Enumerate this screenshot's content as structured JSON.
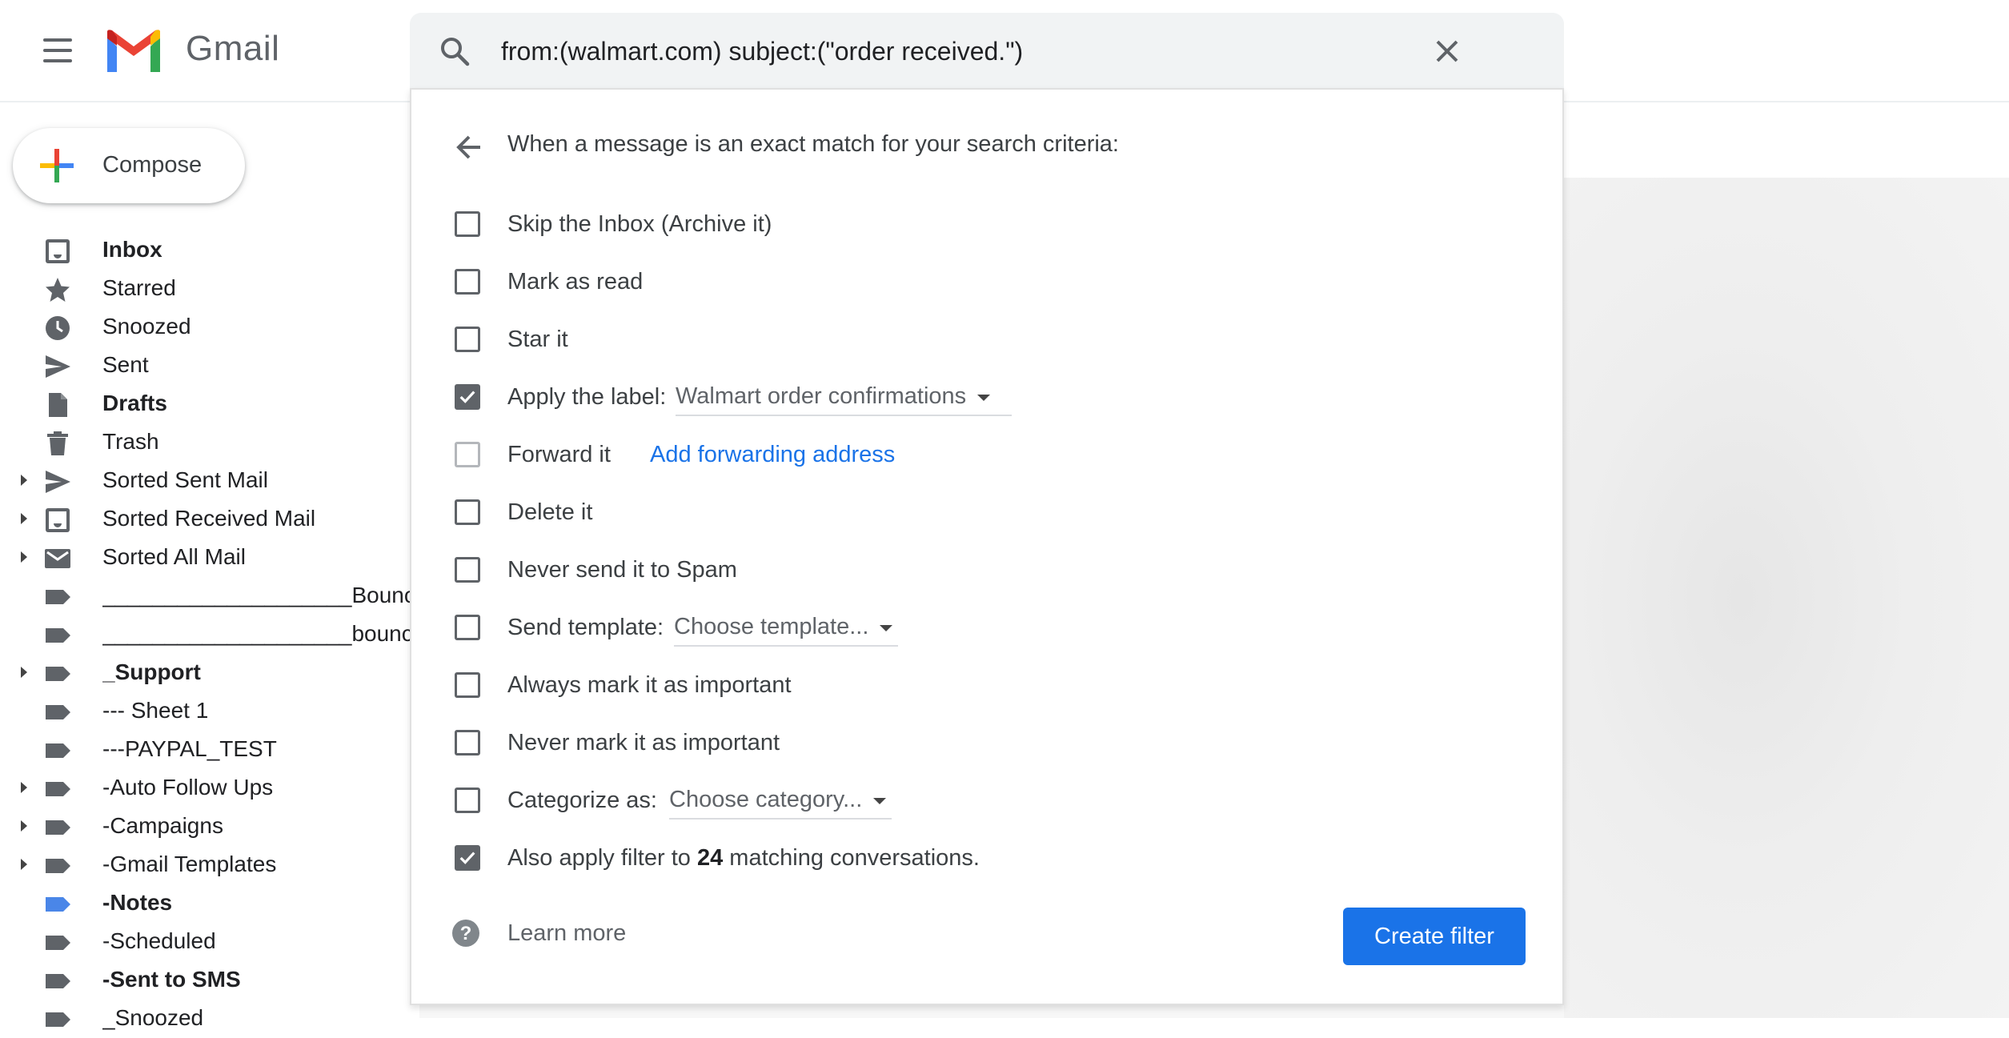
{
  "app": {
    "name": "Gmail"
  },
  "search": {
    "query": "from:(walmart.com) subject:(\"order received.\")"
  },
  "compose": {
    "label": "Compose"
  },
  "sidebar": {
    "items": [
      {
        "label": "Inbox",
        "icon": "inbox-icon",
        "bold": true,
        "expandable": false
      },
      {
        "label": "Starred",
        "icon": "star-icon",
        "bold": false,
        "expandable": false
      },
      {
        "label": "Snoozed",
        "icon": "clock-icon",
        "bold": false,
        "expandable": false
      },
      {
        "label": "Sent",
        "icon": "send-icon",
        "bold": false,
        "expandable": false
      },
      {
        "label": "Drafts",
        "icon": "draft-icon",
        "bold": true,
        "expandable": false
      },
      {
        "label": "Trash",
        "icon": "trash-icon",
        "bold": false,
        "expandable": false
      },
      {
        "label": "Sorted Sent Mail",
        "icon": "send-icon",
        "bold": false,
        "expandable": true
      },
      {
        "label": "Sorted Received Mail",
        "icon": "inbox-icon",
        "bold": false,
        "expandable": true
      },
      {
        "label": "Sorted All Mail",
        "icon": "mail-icon",
        "bold": false,
        "expandable": true
      },
      {
        "label": "____________________Bounce",
        "icon": "label-icon",
        "bold": false,
        "expandable": false
      },
      {
        "label": "____________________bounce",
        "icon": "label-icon",
        "bold": false,
        "expandable": false
      },
      {
        "label": "_Support",
        "icon": "label-icon",
        "bold": true,
        "expandable": true
      },
      {
        "label": "--- Sheet 1",
        "icon": "label-icon",
        "bold": false,
        "expandable": false
      },
      {
        "label": "---PAYPAL_TEST",
        "icon": "label-icon",
        "bold": false,
        "expandable": false
      },
      {
        "label": "-Auto Follow Ups",
        "icon": "label-icon",
        "bold": false,
        "expandable": true
      },
      {
        "label": "-Campaigns",
        "icon": "label-icon",
        "bold": false,
        "expandable": true
      },
      {
        "label": "-Gmail Templates",
        "icon": "label-icon",
        "bold": false,
        "expandable": true
      },
      {
        "label": "-Notes",
        "icon": "label-icon",
        "bold": true,
        "expandable": false,
        "color": "#4a86e8"
      },
      {
        "label": "-Scheduled",
        "icon": "label-icon",
        "bold": false,
        "expandable": false
      },
      {
        "label": "-Sent to SMS",
        "icon": "label-icon",
        "bold": true,
        "expandable": false
      },
      {
        "label": "_Snoozed",
        "icon": "label-icon",
        "bold": false,
        "expandable": false
      }
    ]
  },
  "filter": {
    "heading": "When a message is an exact match for your search criteria:",
    "options": [
      {
        "label": "Skip the Inbox (Archive it)",
        "checked": false
      },
      {
        "label": "Mark as read",
        "checked": false
      },
      {
        "label": "Star it",
        "checked": false
      },
      {
        "label": "Apply the label:",
        "checked": true,
        "dropdown": "Walmart order confirmations"
      },
      {
        "label": "Forward it",
        "checked": false,
        "disabled": true,
        "link": "Add forwarding address"
      },
      {
        "label": "Delete it",
        "checked": false
      },
      {
        "label": "Never send it to Spam",
        "checked": false
      },
      {
        "label": "Send template:",
        "checked": false,
        "dropdown": "Choose template..."
      },
      {
        "label": "Always mark it as important",
        "checked": false
      },
      {
        "label": "Never mark it as important",
        "checked": false
      },
      {
        "label": "Categorize as:",
        "checked": false,
        "dropdown": "Choose category..."
      },
      {
        "label": "Also apply filter to",
        "checked": true,
        "count": "24",
        "suffix": "matching conversations."
      }
    ],
    "learn_more": "Learn more",
    "create_button": "Create filter"
  },
  "colors": {
    "accent": "#1a73e8",
    "checkbox": "#5f6368",
    "label_default": "#5f6368"
  }
}
